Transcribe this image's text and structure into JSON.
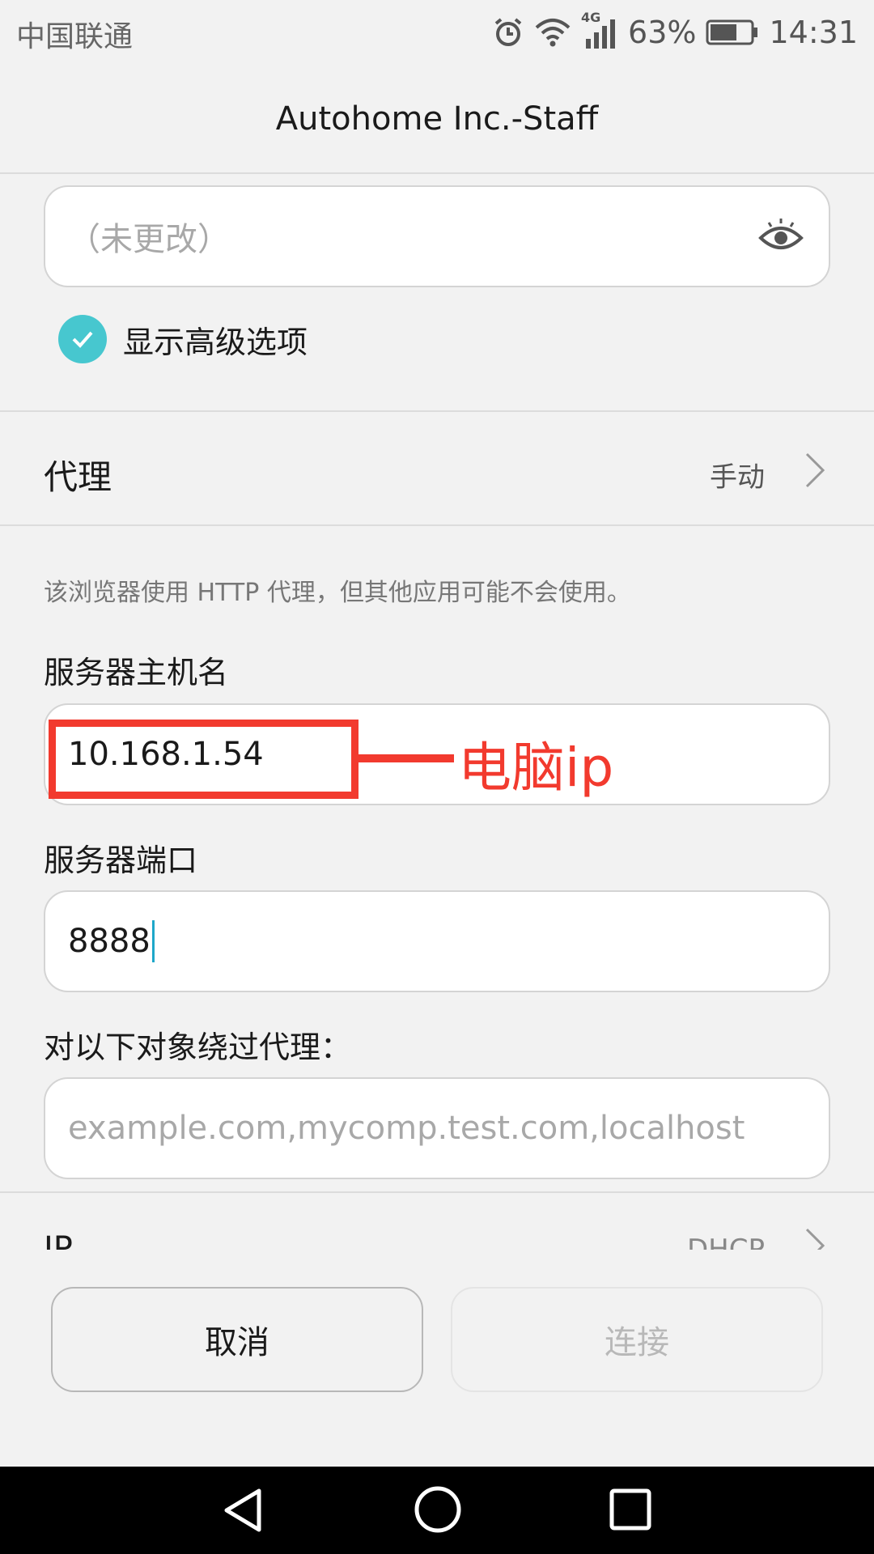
{
  "status_bar": {
    "carrier": "中国联通",
    "network": "4G",
    "battery": "63%",
    "time": "14:31"
  },
  "header": {
    "title": "Autohome Inc.-Staff"
  },
  "password": {
    "placeholder": "（未更改）",
    "toggle_icon": "eye-icon"
  },
  "advanced": {
    "label": "显示高级选项",
    "checked": true,
    "accent": "#47c7cf"
  },
  "proxy": {
    "label": "代理",
    "value": "手动"
  },
  "hint": "该浏览器使用 HTTP 代理，但其他应用可能不会使用。",
  "hostname": {
    "label": "服务器主机名",
    "value": "10.168.1.54"
  },
  "annotation": {
    "text": "电脑ip",
    "color": "#f23a2e"
  },
  "port": {
    "label": "服务器端口",
    "value": "8888"
  },
  "bypass": {
    "label": "对以下对象绕过代理：",
    "placeholder": "example.com,mycomp.test.com,localhost"
  },
  "ip_settings": {
    "label": "IP",
    "value": "DHCP"
  },
  "buttons": {
    "cancel": "取消",
    "connect": "连接"
  }
}
